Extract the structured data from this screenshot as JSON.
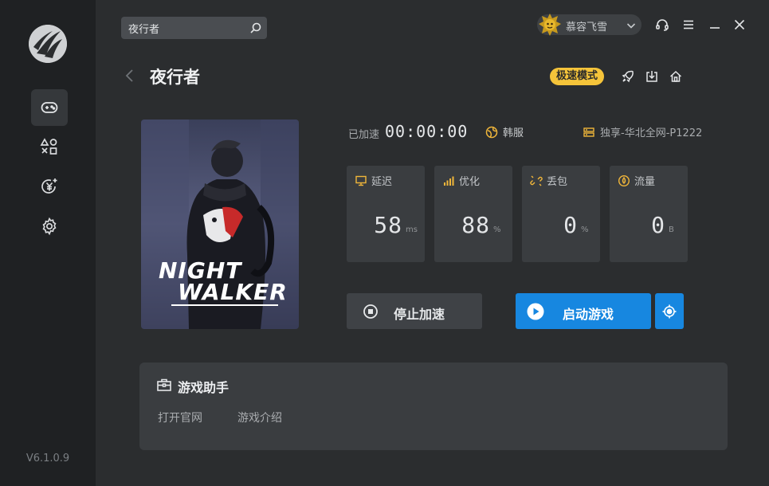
{
  "app": {
    "version": "V6.1.0.9",
    "accent_color": "#1787e0",
    "badge_color": "#f5c43a"
  },
  "sidebar": {
    "items": [
      {
        "icon": "gamepad-icon",
        "active": true
      },
      {
        "icon": "shapes-icon"
      },
      {
        "icon": "yuan-coin-icon"
      },
      {
        "icon": "gear-icon"
      }
    ]
  },
  "search": {
    "value": "夜行者"
  },
  "user": {
    "name": "慕容飞雪"
  },
  "window_controls": [
    "headset-icon",
    "menu-icon",
    "minimize-icon",
    "close-icon"
  ],
  "game": {
    "title": "夜行者",
    "mode_badge": "极速模式",
    "cover_line1": "NIGHT",
    "cover_line2": "WALKER"
  },
  "status": {
    "accelerated_label": "已加速",
    "timer": "00:00:00",
    "region": "韩服",
    "node": "独享-华北全网-P1222"
  },
  "stats": [
    {
      "label": "延迟",
      "value": "58",
      "unit": "ms",
      "icon": "monitor-icon"
    },
    {
      "label": "优化",
      "value": "88",
      "unit": "%",
      "icon": "signal-icon"
    },
    {
      "label": "丢包",
      "value": "0",
      "unit": "%",
      "icon": "broken-link-icon"
    },
    {
      "label": "流量",
      "value": "0",
      "unit": "B",
      "icon": "drop-icon"
    }
  ],
  "actions": {
    "stop_label": "停止加速",
    "start_label": "启动游戏"
  },
  "assistant": {
    "title": "游戏助手",
    "links": [
      "打开官网",
      "游戏介绍"
    ]
  }
}
